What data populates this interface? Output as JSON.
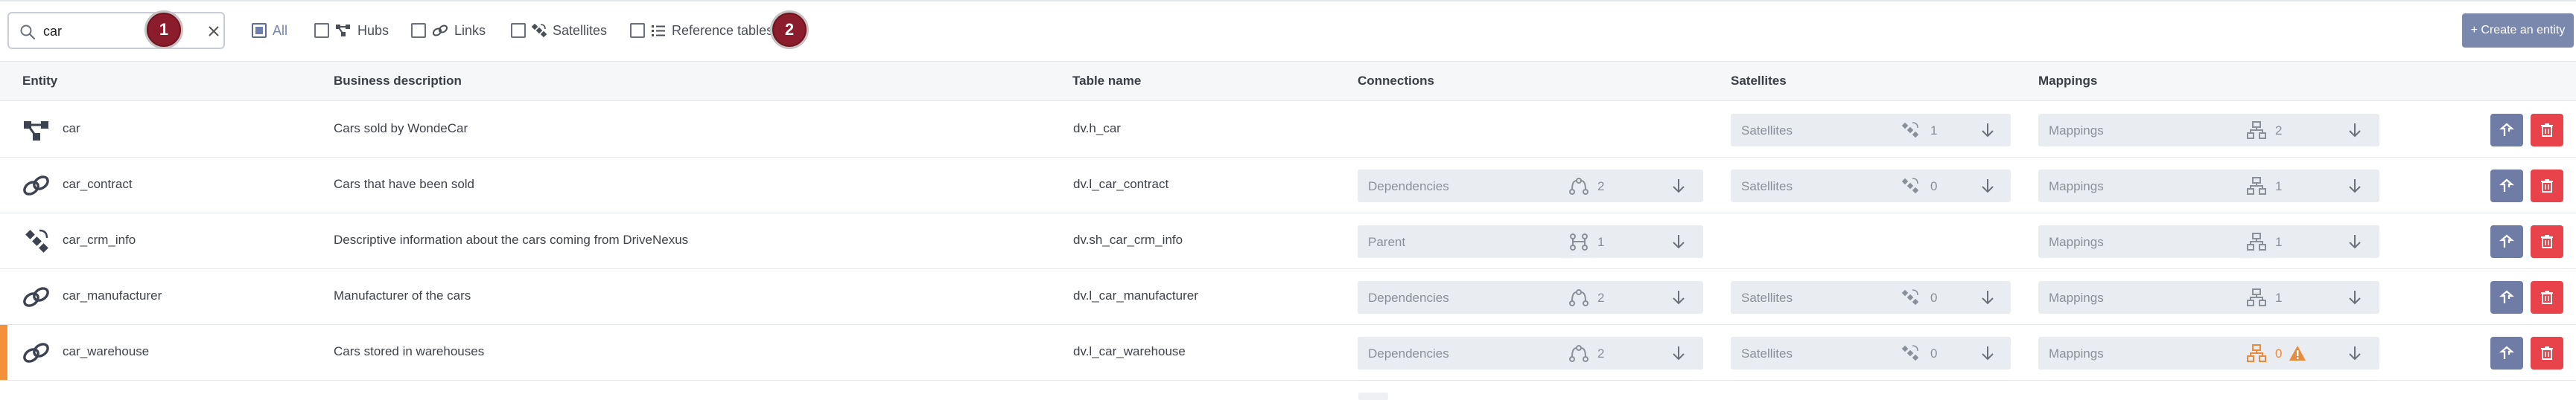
{
  "search": {
    "value": "car",
    "placeholder": ""
  },
  "badges": [
    "1",
    "2"
  ],
  "filters": [
    {
      "label": "All",
      "icon": "none",
      "checked": true
    },
    {
      "label": "Hubs",
      "icon": "hub-icon",
      "checked": false
    },
    {
      "label": "Links",
      "icon": "link-icon",
      "checked": false
    },
    {
      "label": "Satellites",
      "icon": "satellite-icon",
      "checked": false
    },
    {
      "label": "Reference tables",
      "icon": "list-icon",
      "checked": false
    }
  ],
  "create_button": "+ Create an entity",
  "columns": {
    "entity": "Entity",
    "business_description": "Business description",
    "table_name": "Table name",
    "connections": "Connections",
    "satellites": "Satellites",
    "mappings": "Mappings"
  },
  "rows": [
    {
      "entity": "car",
      "type_icon": "hub-icon",
      "description": "Cars sold by WondeCar",
      "table": "dv.h_car",
      "connection": null,
      "satellites": {
        "label": "Satellites",
        "count": "1"
      },
      "mappings": {
        "label": "Mappings",
        "count": "2",
        "warning": false
      },
      "flagged": false
    },
    {
      "entity": "car_contract",
      "type_icon": "link-icon",
      "description": "Cars that have been sold",
      "table": "dv.l_car_contract",
      "connection": {
        "label": "Dependencies",
        "count": "2",
        "icon": "dependencies-icon"
      },
      "satellites": {
        "label": "Satellites",
        "count": "0"
      },
      "mappings": {
        "label": "Mappings",
        "count": "1",
        "warning": false
      },
      "flagged": false
    },
    {
      "entity": "car_crm_info",
      "type_icon": "satellite-icon",
      "description": "Descriptive information about the cars coming from DriveNexus",
      "table": "dv.sh_car_crm_info",
      "connection": {
        "label": "Parent",
        "count": "1",
        "icon": "parent-icon"
      },
      "satellites": null,
      "mappings": {
        "label": "Mappings",
        "count": "1",
        "warning": false
      },
      "flagged": false
    },
    {
      "entity": "car_manufacturer",
      "type_icon": "link-icon",
      "description": "Manufacturer of the cars",
      "table": "dv.l_car_manufacturer",
      "connection": {
        "label": "Dependencies",
        "count": "2",
        "icon": "dependencies-icon"
      },
      "satellites": {
        "label": "Satellites",
        "count": "0"
      },
      "mappings": {
        "label": "Mappings",
        "count": "1",
        "warning": false
      },
      "flagged": false
    },
    {
      "entity": "car_warehouse",
      "type_icon": "link-icon",
      "description": "Cars stored in warehouses",
      "table": "dv.l_car_warehouse",
      "connection": {
        "label": "Dependencies",
        "count": "2",
        "icon": "dependencies-icon"
      },
      "satellites": {
        "label": "Satellites",
        "count": "0"
      },
      "mappings": {
        "label": "Mappings",
        "count": "0",
        "warning": true
      },
      "flagged": true
    }
  ],
  "colors": {
    "accent": "#7a88ae",
    "delete": "#e8434a",
    "badge": "#8b1c2b",
    "warning": "#e98b3a",
    "flag": "#f2913a"
  }
}
